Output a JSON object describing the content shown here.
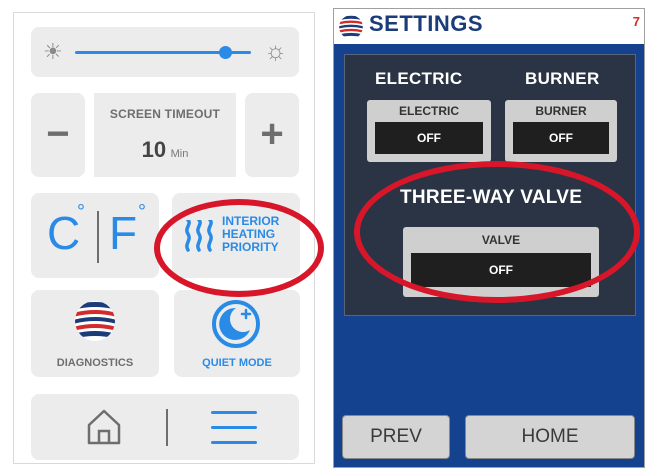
{
  "left_panel": {
    "brightness": {
      "level": 0.85,
      "small_icon": "sun-small-icon",
      "large_icon": "sun-large-icon",
      "accent": "#2a8be6"
    },
    "screen_timeout": {
      "label": "SCREEN TIMEOUT",
      "value": "10",
      "unit": "Min",
      "minus_label": "−",
      "plus_label": "+"
    },
    "units": {
      "celsius": "C",
      "fahrenheit": "F",
      "degree": "°"
    },
    "heating": {
      "line1": "INTERIOR",
      "line2": "HEATING",
      "line3": "PRIORITY",
      "icon": "heat-waves-icon"
    },
    "diagnostics": {
      "label": "DIAGNOSTICS",
      "icon": "flag-globe-icon"
    },
    "quiet_mode": {
      "label": "QUIET MODE",
      "icon": "moon-icon"
    },
    "nav": {
      "home_icon": "home-icon",
      "menu_icon": "hamburger-menu-icon"
    }
  },
  "right_panel": {
    "title": "SETTINGS",
    "badge": "7",
    "electric": {
      "caption": "ELECTRIC",
      "label": "ELECTRIC",
      "value": "OFF"
    },
    "burner": {
      "caption": "BURNER",
      "label": "BURNER",
      "value": "OFF"
    },
    "valve": {
      "caption": "THREE-WAY VALVE",
      "label": "VALVE",
      "value": "OFF"
    },
    "buttons": {
      "prev": "PREV",
      "home": "HOME"
    },
    "colors": {
      "background": "#14428f",
      "box": "#2a3444"
    }
  },
  "annotation": {
    "color": "#d8162a"
  }
}
